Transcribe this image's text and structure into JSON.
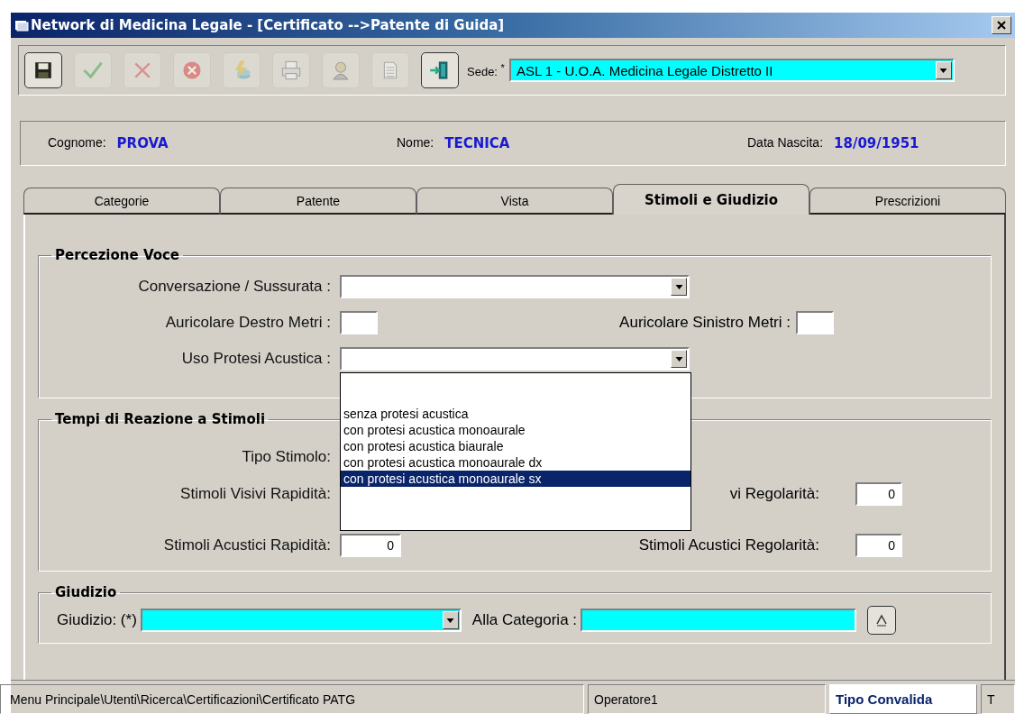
{
  "window": {
    "title": "Network di Medicina Legale - [Certificato -->Patente di Guida]"
  },
  "toolbar": {
    "buttons": [
      {
        "kind": "save",
        "disabled": false
      },
      {
        "kind": "confirm",
        "disabled": true
      },
      {
        "kind": "cancel",
        "disabled": true
      },
      {
        "kind": "delete",
        "disabled": true
      },
      {
        "kind": "lightning",
        "disabled": true
      },
      {
        "kind": "print",
        "disabled": true
      },
      {
        "kind": "person",
        "disabled": true
      },
      {
        "kind": "document",
        "disabled": true
      },
      {
        "kind": "exit",
        "disabled": false
      }
    ],
    "sede": {
      "label": "Sede:",
      "required_mark": "*",
      "value": "ASL 1 - U.O.A. Medicina Legale Distretto II"
    }
  },
  "patient": [
    {
      "label": "Cognome:",
      "value": "PROVA"
    },
    {
      "label": "Nome:",
      "value": "TECNICA"
    },
    {
      "label": "Data Nascita:",
      "value": "18/09/1951"
    }
  ],
  "tabs": [
    {
      "label": "Categorie",
      "selected": false
    },
    {
      "label": "Patente",
      "selected": false
    },
    {
      "label": "Vista",
      "selected": false
    },
    {
      "label": "Stimoli e Giudizio",
      "selected": true
    },
    {
      "label": "Prescrizioni",
      "selected": false
    }
  ],
  "percezione_voce": {
    "title": "Percezione Voce",
    "conversazione_label": "Conversazione / Sussurata :",
    "destro_label": "Auricolare Destro Metri :",
    "sinistro_label": "Auricolare Sinistro Metri :",
    "protesi_label": "Uso Protesi Acustica :",
    "protesi_options": [
      {
        "text": "senza protesi acustica",
        "selected": false
      },
      {
        "text": "con protesi acustica monoaurale",
        "selected": false
      },
      {
        "text": "con protesi acustica biaurale",
        "selected": false
      },
      {
        "text": "con protesi acustica monoaurale dx",
        "selected": false
      },
      {
        "text": "con protesi acustica monoaurale sx",
        "selected": true
      }
    ]
  },
  "tempi_reazione": {
    "title": "Tempi di Reazione a Stimoli",
    "tipo_label": "Tipo Stimolo:",
    "visivi_rapidita_label": "Stimoli Visivi Rapidità:",
    "visivi_regolarita_label": "vi Regolarità:",
    "visivi_regolarita_value": "0",
    "acustici_rapidita_label": "Stimoli Acustici Rapidità:",
    "acustici_rapidita_value": "0",
    "acustici_regolarita_label": "Stimoli Acustici Regolarità:",
    "acustici_regolarita_value": "0"
  },
  "giudizio": {
    "title": "Giudizio",
    "giudizio_label": "Giudizio: (*)",
    "categoria_label": "Alla Categoria :"
  },
  "status_bar": {
    "path": "Menu Principale\\Utenti\\Ricerca\\Certificazioni\\Certificato PATG",
    "user": "Operatore1",
    "mode": "Tipo Convalida",
    "extra": "T"
  }
}
